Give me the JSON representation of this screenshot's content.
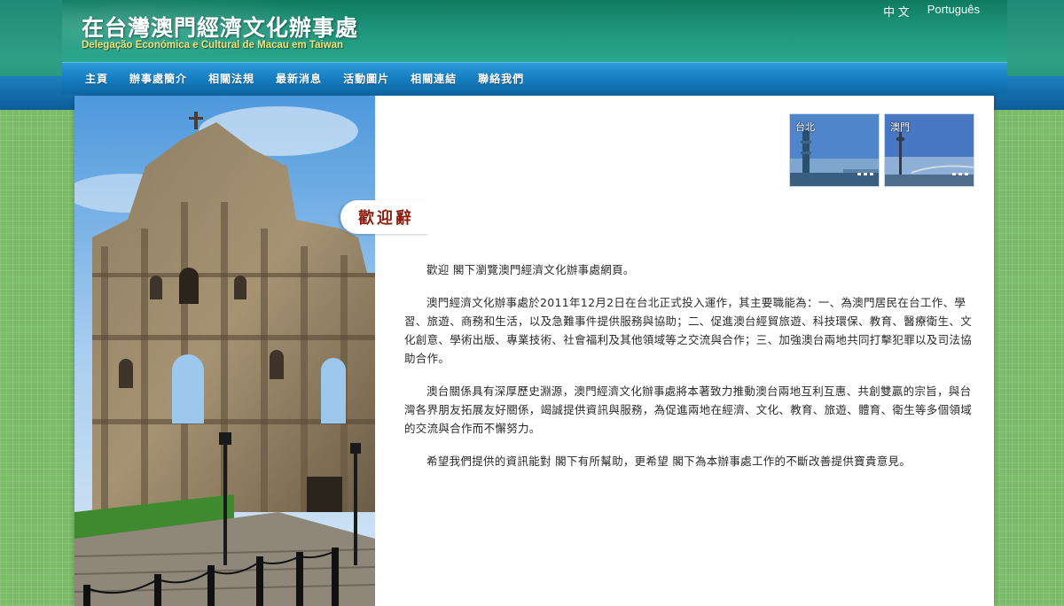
{
  "header": {
    "title": "在台灣澳門經濟文化辦事處",
    "subtitle": "Delegação Económica e Cultural de Macau em Taiwan"
  },
  "languages": [
    "中 文",
    "Português"
  ],
  "nav": {
    "items": [
      "主頁",
      "辦事處簡介",
      "相關法規",
      "最新消息",
      "活動圖片",
      "相關連結",
      "聯絡我們"
    ]
  },
  "welcome": {
    "heading": "歡迎辭",
    "paragraphs": [
      "歡迎 閣下瀏覽澳門經濟文化辦事處網頁。",
      "澳門經濟文化辦事處於2011年12月2日在台北正式投入運作，其主要職能為：一、為澳門居民在台工作、學習、旅遊、商務和生活，以及急難事件提供服務與協助；二、促進澳台經貿旅遊、科技環保、教育、醫療衛生、文化創意、學術出版、專業技術、社會福利及其他領域等之交流與合作；三、加強澳台兩地共同打擊犯罪以及司法協助合作。",
      "澳台關係具有深厚歷史淵源，澳門經濟文化辦事處將本著致力推動澳台兩地互利互惠、共創雙贏的宗旨，與台灣各界朋友拓展友好關係，竭誠提供資訊與服務，為促進兩地在經濟、文化、教育、旅遊、體育、衛生等多個領域的交流與合作而不懈努力。",
      "希望我們提供的資訊能對 閣下有所幫助，更希望 閣下為本辦事處工作的不斷改善提供寶貴意見。"
    ]
  },
  "thumbnails": [
    {
      "label": "台北",
      "icon": "taipei101-image"
    },
    {
      "label": "澳門",
      "icon": "macau-tower-image"
    }
  ],
  "colors": {
    "header_green": "#1e947a",
    "nav_blue": "#157ec1",
    "subtitle_yellow": "#f3e27a",
    "welcome_red": "#8a1f12",
    "page_green": "#7cbb6a"
  }
}
